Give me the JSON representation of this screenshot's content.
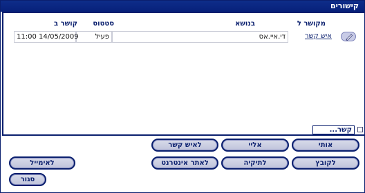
{
  "window": {
    "title": "קישורים"
  },
  "table": {
    "columns": [
      "מקושר ל",
      "בנושא",
      "סטטוס",
      "קושר ב"
    ],
    "rows": [
      {
        "linked_to": "איש קשר",
        "subject": "די.איי.אס",
        "status": "פעיל",
        "linked_at": "11:00 14/05/2009"
      }
    ]
  },
  "search": {
    "value": "קשר..."
  },
  "buttons": {
    "me": "אותי",
    "to_me": "אליי",
    "to_contact": "לאיש קשר",
    "to_file": "לקובץ",
    "to_folder": "לתיקיה",
    "to_website": "לאתר אינטרנט",
    "to_email": "לאימייל",
    "close": "סגור"
  },
  "icons": {
    "edit": "pencil-icon"
  }
}
